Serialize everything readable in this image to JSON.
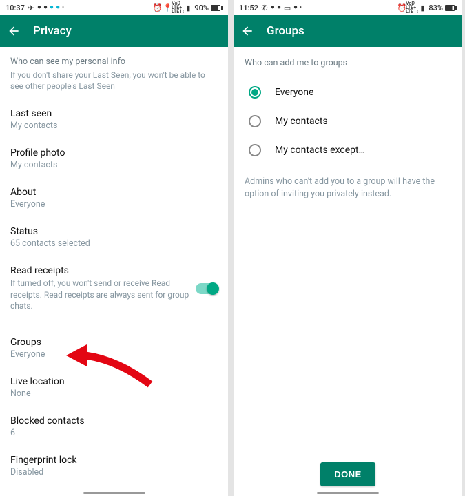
{
  "left": {
    "status": {
      "time": "10:37",
      "battery": "90%"
    },
    "title": "Privacy",
    "section_header": "Who can see my personal info",
    "section_sub": "If you don't share your Last Seen, you won't be able to see other people's Last Seen",
    "items": {
      "last_seen": {
        "label": "Last seen",
        "value": "My contacts"
      },
      "profile_photo": {
        "label": "Profile photo",
        "value": "My contacts"
      },
      "about": {
        "label": "About",
        "value": "Everyone"
      },
      "status": {
        "label": "Status",
        "value": "65 contacts selected"
      },
      "read_receipts": {
        "label": "Read receipts",
        "desc": "If turned off, you won't send or receive Read receipts. Read receipts are always sent for group chats."
      },
      "groups": {
        "label": "Groups",
        "value": "Everyone"
      },
      "live_location": {
        "label": "Live location",
        "value": "None"
      },
      "blocked": {
        "label": "Blocked contacts",
        "value": "6"
      },
      "fingerprint": {
        "label": "Fingerprint lock",
        "value": "Disabled"
      }
    }
  },
  "right": {
    "status": {
      "time": "11:52",
      "battery": "83%"
    },
    "title": "Groups",
    "heading": "Who can add me to groups",
    "options": [
      {
        "label": "Everyone",
        "checked": true
      },
      {
        "label": "My contacts",
        "checked": false
      },
      {
        "label": "My contacts except…",
        "checked": false
      }
    ],
    "note": "Admins who can't add you to a group will have the option of inviting you privately instead.",
    "done": "DONE"
  }
}
